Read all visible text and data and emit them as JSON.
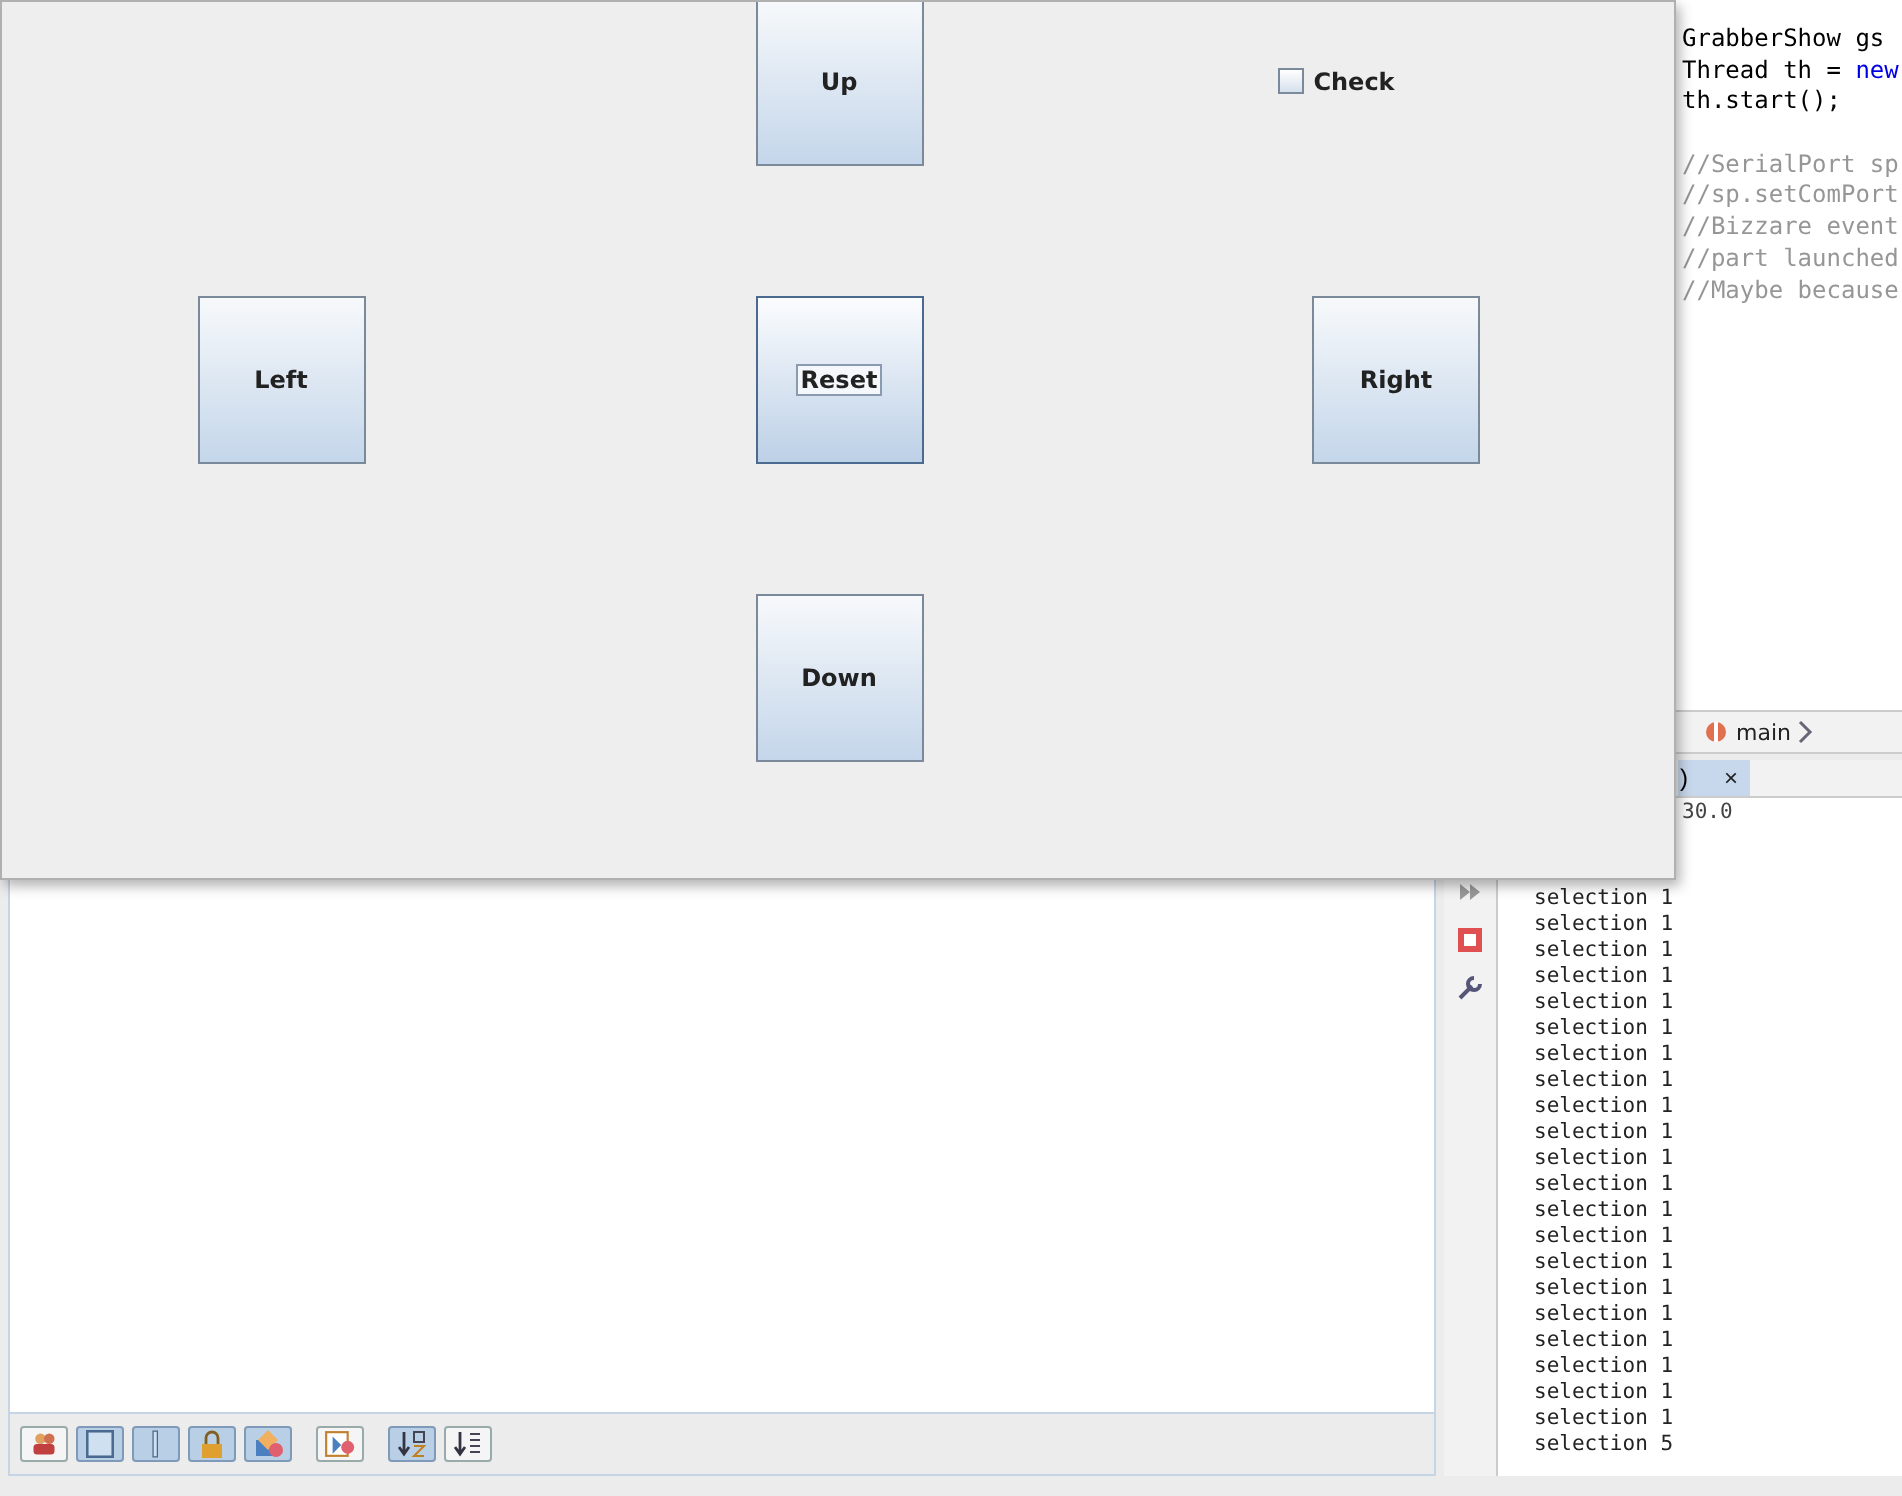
{
  "swing_window": {
    "buttons": [
      {
        "label": "Up",
        "focused": false
      },
      {
        "label": "Left",
        "focused": false
      },
      {
        "label": "Reset",
        "focused": true
      },
      {
        "label": "Right",
        "focused": false
      },
      {
        "label": "Down",
        "focused": false
      }
    ],
    "checkbox": {
      "label": "Check",
      "checked": false
    }
  },
  "editor": {
    "lines": [
      {
        "kind": "code",
        "tokens": [
          {
            "text": "GrabberShow gs",
            "kind": "plain"
          }
        ]
      },
      {
        "kind": "code",
        "tokens": [
          {
            "text": "Thread th = ",
            "kind": "plain"
          },
          {
            "text": "new",
            "kind": "keyword"
          }
        ]
      },
      {
        "kind": "code",
        "tokens": [
          {
            "text": "th.start();",
            "kind": "plain"
          }
        ]
      },
      {
        "kind": "blank"
      },
      {
        "kind": "code",
        "tokens": [
          {
            "text": "//SerialPort sp",
            "kind": "comment"
          }
        ]
      },
      {
        "kind": "code",
        "tokens": [
          {
            "text": "//sp.setComPort",
            "kind": "comment"
          }
        ]
      },
      {
        "kind": "code",
        "tokens": [
          {
            "text": "//Bizzare event",
            "kind": "comment"
          }
        ]
      },
      {
        "kind": "code",
        "tokens": [
          {
            "text": "//part launched",
            "kind": "comment"
          }
        ]
      },
      {
        "kind": "code",
        "tokens": [
          {
            "text": "//Maybe because",
            "kind": "comment"
          }
        ]
      }
    ],
    "breadcrumb": "main"
  },
  "output": {
    "tab": {
      "label": ")",
      "close": "×"
    },
    "lines": [
      "30.0",
      "selection 1",
      "selection 1",
      "selection 1",
      "selection 1",
      "selection 1",
      "selection 1",
      "selection 1",
      "selection 1",
      "selection 1",
      "selection 1",
      "selection 1",
      "selection 1",
      "selection 1",
      "selection 1",
      "selection 1",
      "selection 1",
      "selection 1",
      "selection 1",
      "selection 1",
      "selection 1",
      "selection 1",
      "selection 5"
    ]
  },
  "toolbar": [
    {
      "selected": false
    },
    {
      "selected": true
    },
    {
      "selected": true
    },
    {
      "selected": true
    },
    {
      "selected": true
    },
    {
      "selected": false
    },
    {
      "selected": true
    },
    {
      "selected": false
    }
  ]
}
